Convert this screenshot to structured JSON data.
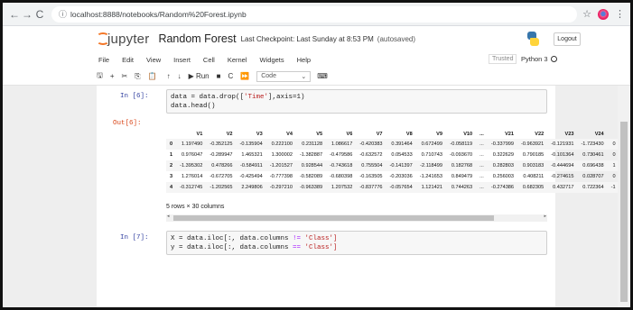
{
  "browser": {
    "nav": [
      "←",
      "→",
      "C"
    ],
    "url_icon": "ⓘ",
    "url": "localhost:8888/notebooks/Random%20Forest.ipynb",
    "star": "☆",
    "menu_dots": "⋮"
  },
  "header": {
    "logo_text": "jupyter",
    "notebook_name": "Random Forest",
    "checkpoint": "Last Checkpoint: Last Sunday at 8:53 PM",
    "autosaved": "(autosaved)",
    "logout": "Logout"
  },
  "menu": {
    "items": [
      "File",
      "Edit",
      "View",
      "Insert",
      "Cell",
      "Kernel",
      "Widgets",
      "Help"
    ],
    "trusted": "Trusted",
    "kernel": "Python 3"
  },
  "toolbar": {
    "save": "🖫",
    "add": "+",
    "cut": "✂",
    "copy": "⎘",
    "paste": "📋",
    "up": "↑",
    "down": "↓",
    "run": "▶ Run",
    "stop": "■",
    "restart": "C",
    "fastforward": "⏩",
    "cell_type": "Code",
    "cell_type_arrow": "⌄",
    "keyboard": "⌨"
  },
  "cells": {
    "in6_prompt": "In [6]:",
    "in6_line1_a": "data = data.drop([",
    "in6_line1_str": "'Time'",
    "in6_line1_b": "],axis=1)",
    "in6_line2": "data.head()",
    "out6_prompt": "Out[6]:",
    "in7_prompt": "In [7]:",
    "in7_line1_a": "X = data.iloc[:, data.columns ",
    "in7_line1_op": "!=",
    "in7_line1_str": " 'Class']",
    "in7_line2_a": "y = data.iloc[:, data.columns ",
    "in7_line2_op": "==",
    "in7_line2_str": " 'Class']"
  },
  "dataframe": {
    "columns": [
      "",
      "V1",
      "V2",
      "V3",
      "V4",
      "V5",
      "V6",
      "V7",
      "V8",
      "V9",
      "V10",
      "...",
      "V21",
      "V22",
      "V23",
      "V24",
      ""
    ],
    "rows": [
      [
        "0",
        "1.197490",
        "-0.352125",
        "-0.135904",
        "0.222100",
        "0.231128",
        "1.086617",
        "-0.420383",
        "0.391464",
        "0.672499",
        "-0.058119",
        "...",
        "-0.337999",
        "-0.963921",
        "-0.121931",
        "-1.723430",
        "0"
      ],
      [
        "1",
        "0.976047",
        "-0.289947",
        "1.465321",
        "1.300002",
        "-1.382887",
        "-0.479586",
        "-0.632572",
        "0.054533",
        "0.710743",
        "-0.093670",
        "...",
        "0.322629",
        "0.790185",
        "-0.101364",
        "0.730461",
        "0"
      ],
      [
        "2",
        "-1.395302",
        "0.478266",
        "-0.584911",
        "-1.201527",
        "0.928544",
        "-0.743618",
        "0.755504",
        "-0.141397",
        "-2.118499",
        "0.182768",
        "...",
        "0.282803",
        "0.903183",
        "-0.444694",
        "0.696438",
        "1"
      ],
      [
        "3",
        "1.276014",
        "-0.672705",
        "-0.425494",
        "-0.777398",
        "-0.582089",
        "-0.680398",
        "-0.163505",
        "-0.203036",
        "-1.241653",
        "0.849479",
        "...",
        "0.256003",
        "0.408211",
        "-0.274615",
        "0.028707",
        "0"
      ],
      [
        "4",
        "-0.312745",
        "-1.202565",
        "2.249806",
        "-0.297210",
        "-0.963389",
        "1.207532",
        "-0.837776",
        "-0.057654",
        "1.121421",
        "0.744263",
        "...",
        "-0.274386",
        "0.682305",
        "0.432717",
        "0.722364",
        "-1"
      ]
    ],
    "summary": "5 rows × 30 columns",
    "scroll_left": "◂",
    "scroll_right": "▸"
  }
}
